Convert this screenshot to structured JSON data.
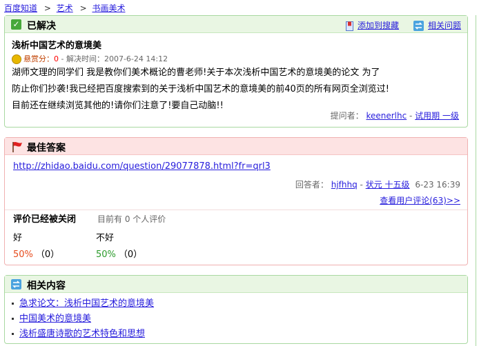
{
  "breadcrumb": {
    "home": "百度知道",
    "sep": ">",
    "level1": "艺术",
    "level2": "书画美术"
  },
  "question": {
    "status_title": "已解决",
    "add_favorite": "添加到搜藏",
    "related_questions": "相关问题",
    "title": "浅析中国艺术的意境美",
    "bounty_label": "悬赏分：",
    "bounty_value": "0",
    "solved_time": "- 解决时间：2007-6-24 14:12",
    "body_lines": [
      "湖师文理的同学们  我是教你们美术概论的曹老师!关于本次浅析中国艺术的意境美的论文  为了",
      "防止你们抄袭!我已经把百度搜索到的关于浅析中国艺术的意境美的前40页的所有网页全浏览过!",
      "目前还在继续浏览其他的!请你们注意了!要自己动脑!!"
    ],
    "asker_label": "提问者：",
    "asker_name": "keenerlhc",
    "asker_sep": " - ",
    "asker_level": "试用期 一级"
  },
  "best_answer": {
    "title": "最佳答案",
    "url": "http://zhidao.baidu.com/question/29077878.html?fr=qrl3",
    "answerer_label": "回答者：",
    "answerer_name": "hjfhhq",
    "answerer_sep": " - ",
    "answerer_level": "状元 十五级",
    "answer_time": "6-23 16:39",
    "view_comments": "查看用户评论(63)>>",
    "eval_closed": "评价已经被关闭",
    "eval_count": "目前有 0 个人评价",
    "good_label": "好",
    "good_pct": "50%",
    "good_count": "（0）",
    "bad_label": "不好",
    "bad_pct": "50%",
    "bad_count": "（0）"
  },
  "related": {
    "title": "相关内容",
    "items": [
      "急求论文：浅析中国艺术的意境美",
      "中国美术的意境美",
      "浅析盛唐诗歌的艺术特色和思想"
    ]
  },
  "colors": {
    "link": "#261cdc",
    "green_border": "#a8d8a0",
    "red_border": "#f0b0b0",
    "good": "#e64b1c",
    "bad": "#2a9a2a"
  }
}
